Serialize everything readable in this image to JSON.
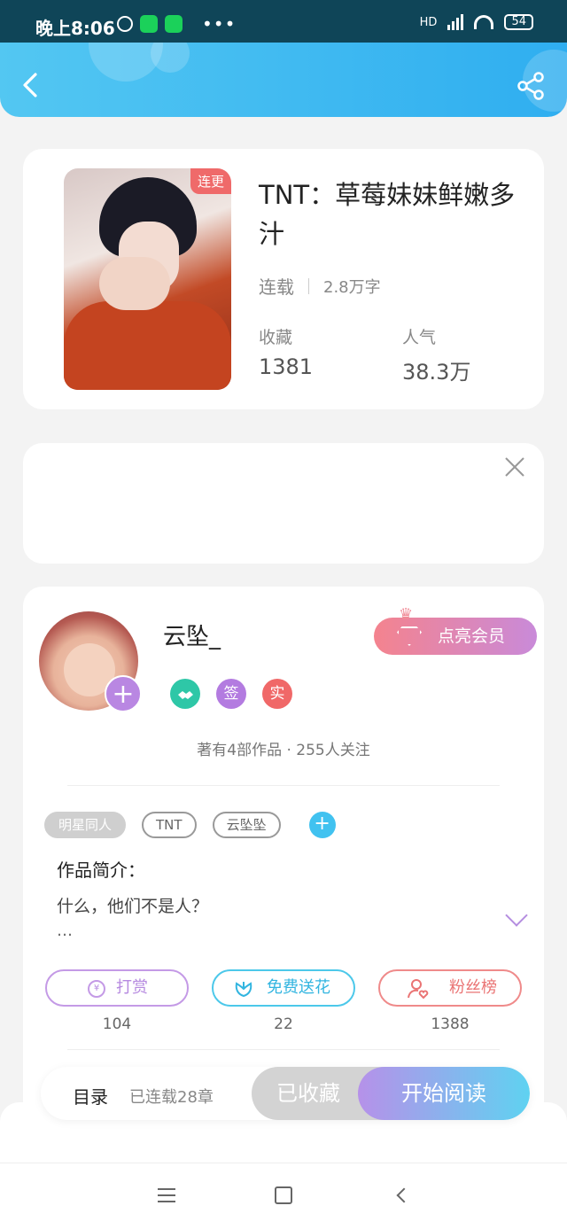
{
  "status_bar": {
    "time": "晚上8:06",
    "dots": "•••",
    "network": "HD",
    "battery": "54"
  },
  "book": {
    "badge": "连更",
    "title": "TNT：草莓妹妹鲜嫩多汁",
    "status": "连载",
    "words": "2.8万字",
    "fav_label": "收藏",
    "fav_value": "1381",
    "pop_label": "人气",
    "pop_value": "38.3万"
  },
  "author": {
    "name": "云坠_",
    "follow_plus": "+",
    "badges": [
      "签",
      "实"
    ],
    "vip_button": "点亮会员",
    "stats": "著有4部作品 · 255人关注",
    "tags": [
      "明星同人",
      "TNT",
      "云坠坠"
    ],
    "tag_add": "+",
    "intro_label": "作品简介：",
    "intro_text": "什么，他们不是人？",
    "intro_more": "…",
    "actions": [
      {
        "label": "打赏",
        "count": "104",
        "icon": "¥"
      },
      {
        "label": "免费送花",
        "count": "22",
        "icon": ""
      },
      {
        "label": "粉丝榜",
        "count": "1388",
        "icon": ""
      }
    ]
  },
  "bottom": {
    "toc": "目录",
    "toc_sub": "已连载28章",
    "fav_btn": "已收藏",
    "read_btn": "开始阅读"
  },
  "colors": {
    "header": "#2faef0",
    "accent_purple": "#b37be0",
    "accent_teal": "#41c2f0",
    "accent_red": "#f06868"
  }
}
